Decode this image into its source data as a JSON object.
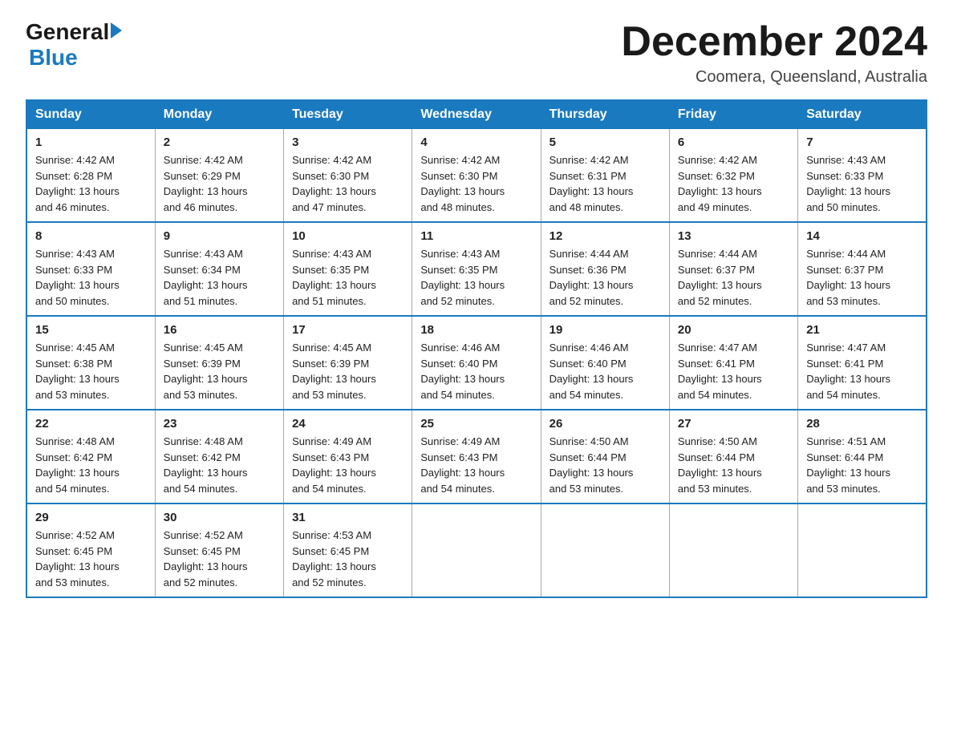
{
  "logo": {
    "general": "General",
    "blue": "Blue"
  },
  "title": {
    "month": "December 2024",
    "location": "Coomera, Queensland, Australia"
  },
  "weekdays": [
    "Sunday",
    "Monday",
    "Tuesday",
    "Wednesday",
    "Thursday",
    "Friday",
    "Saturday"
  ],
  "weeks": [
    [
      {
        "day": "1",
        "sunrise": "4:42 AM",
        "sunset": "6:28 PM",
        "daylight": "13 hours and 46 minutes."
      },
      {
        "day": "2",
        "sunrise": "4:42 AM",
        "sunset": "6:29 PM",
        "daylight": "13 hours and 46 minutes."
      },
      {
        "day": "3",
        "sunrise": "4:42 AM",
        "sunset": "6:30 PM",
        "daylight": "13 hours and 47 minutes."
      },
      {
        "day": "4",
        "sunrise": "4:42 AM",
        "sunset": "6:30 PM",
        "daylight": "13 hours and 48 minutes."
      },
      {
        "day": "5",
        "sunrise": "4:42 AM",
        "sunset": "6:31 PM",
        "daylight": "13 hours and 48 minutes."
      },
      {
        "day": "6",
        "sunrise": "4:42 AM",
        "sunset": "6:32 PM",
        "daylight": "13 hours and 49 minutes."
      },
      {
        "day": "7",
        "sunrise": "4:43 AM",
        "sunset": "6:33 PM",
        "daylight": "13 hours and 50 minutes."
      }
    ],
    [
      {
        "day": "8",
        "sunrise": "4:43 AM",
        "sunset": "6:33 PM",
        "daylight": "13 hours and 50 minutes."
      },
      {
        "day": "9",
        "sunrise": "4:43 AM",
        "sunset": "6:34 PM",
        "daylight": "13 hours and 51 minutes."
      },
      {
        "day": "10",
        "sunrise": "4:43 AM",
        "sunset": "6:35 PM",
        "daylight": "13 hours and 51 minutes."
      },
      {
        "day": "11",
        "sunrise": "4:43 AM",
        "sunset": "6:35 PM",
        "daylight": "13 hours and 52 minutes."
      },
      {
        "day": "12",
        "sunrise": "4:44 AM",
        "sunset": "6:36 PM",
        "daylight": "13 hours and 52 minutes."
      },
      {
        "day": "13",
        "sunrise": "4:44 AM",
        "sunset": "6:37 PM",
        "daylight": "13 hours and 52 minutes."
      },
      {
        "day": "14",
        "sunrise": "4:44 AM",
        "sunset": "6:37 PM",
        "daylight": "13 hours and 53 minutes."
      }
    ],
    [
      {
        "day": "15",
        "sunrise": "4:45 AM",
        "sunset": "6:38 PM",
        "daylight": "13 hours and 53 minutes."
      },
      {
        "day": "16",
        "sunrise": "4:45 AM",
        "sunset": "6:39 PM",
        "daylight": "13 hours and 53 minutes."
      },
      {
        "day": "17",
        "sunrise": "4:45 AM",
        "sunset": "6:39 PM",
        "daylight": "13 hours and 53 minutes."
      },
      {
        "day": "18",
        "sunrise": "4:46 AM",
        "sunset": "6:40 PM",
        "daylight": "13 hours and 54 minutes."
      },
      {
        "day": "19",
        "sunrise": "4:46 AM",
        "sunset": "6:40 PM",
        "daylight": "13 hours and 54 minutes."
      },
      {
        "day": "20",
        "sunrise": "4:47 AM",
        "sunset": "6:41 PM",
        "daylight": "13 hours and 54 minutes."
      },
      {
        "day": "21",
        "sunrise": "4:47 AM",
        "sunset": "6:41 PM",
        "daylight": "13 hours and 54 minutes."
      }
    ],
    [
      {
        "day": "22",
        "sunrise": "4:48 AM",
        "sunset": "6:42 PM",
        "daylight": "13 hours and 54 minutes."
      },
      {
        "day": "23",
        "sunrise": "4:48 AM",
        "sunset": "6:42 PM",
        "daylight": "13 hours and 54 minutes."
      },
      {
        "day": "24",
        "sunrise": "4:49 AM",
        "sunset": "6:43 PM",
        "daylight": "13 hours and 54 minutes."
      },
      {
        "day": "25",
        "sunrise": "4:49 AM",
        "sunset": "6:43 PM",
        "daylight": "13 hours and 54 minutes."
      },
      {
        "day": "26",
        "sunrise": "4:50 AM",
        "sunset": "6:44 PM",
        "daylight": "13 hours and 53 minutes."
      },
      {
        "day": "27",
        "sunrise": "4:50 AM",
        "sunset": "6:44 PM",
        "daylight": "13 hours and 53 minutes."
      },
      {
        "day": "28",
        "sunrise": "4:51 AM",
        "sunset": "6:44 PM",
        "daylight": "13 hours and 53 minutes."
      }
    ],
    [
      {
        "day": "29",
        "sunrise": "4:52 AM",
        "sunset": "6:45 PM",
        "daylight": "13 hours and 53 minutes."
      },
      {
        "day": "30",
        "sunrise": "4:52 AM",
        "sunset": "6:45 PM",
        "daylight": "13 hours and 52 minutes."
      },
      {
        "day": "31",
        "sunrise": "4:53 AM",
        "sunset": "6:45 PM",
        "daylight": "13 hours and 52 minutes."
      },
      null,
      null,
      null,
      null
    ]
  ],
  "labels": {
    "sunrise": "Sunrise:",
    "sunset": "Sunset:",
    "daylight": "Daylight:"
  }
}
